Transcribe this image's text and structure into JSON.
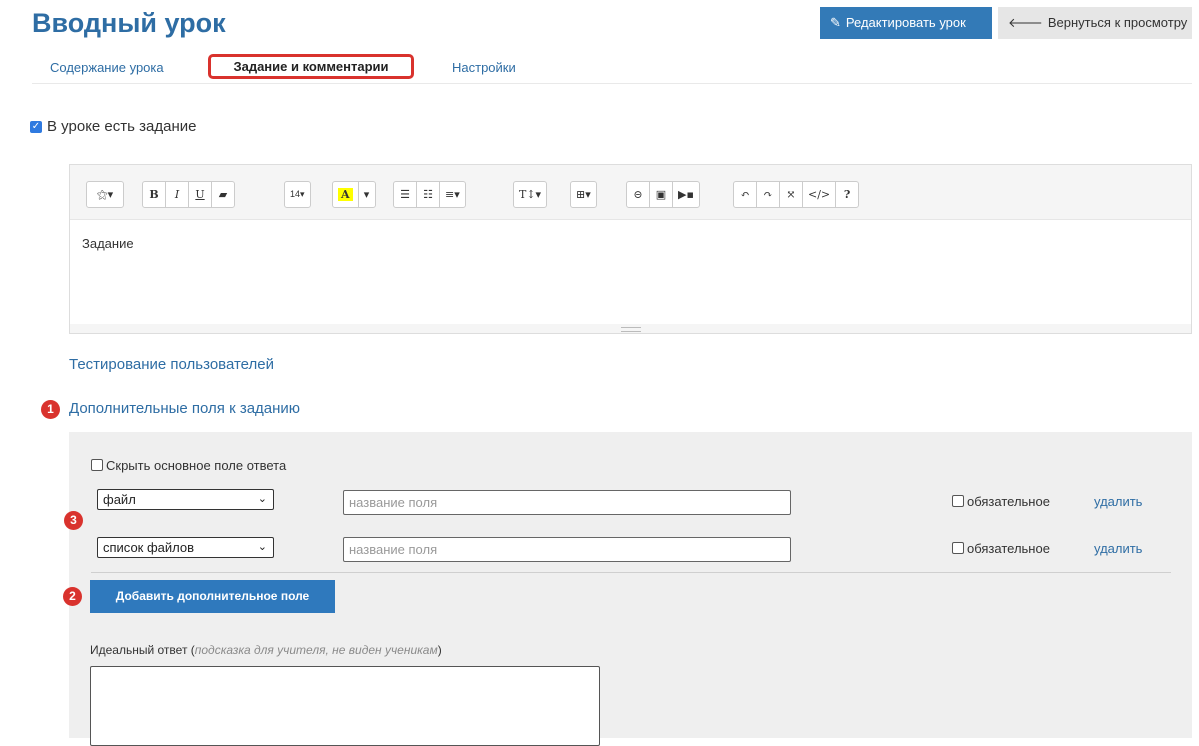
{
  "header": {
    "title": "Вводный урок",
    "edit_label": "Редактировать урок",
    "back_label": "Вернуться к просмотру"
  },
  "tabs": [
    {
      "label": "Содержание урока"
    },
    {
      "label": "Задание и комментарии",
      "active": true
    },
    {
      "label": "Настройки"
    }
  ],
  "has_task": {
    "label": "В уроке есть задание",
    "checked": true
  },
  "editor": {
    "font_size": "14",
    "body_text": "Задание"
  },
  "links": {
    "testing": "Тестирование пользователей",
    "extra_fields": "Дополнительные поля к заданию"
  },
  "badges": {
    "one": "1",
    "two": "2",
    "three": "3"
  },
  "extra_fields": {
    "hide_main_label": "Скрыть основное поле ответа",
    "rows": [
      {
        "type": "файл",
        "placeholder": "название поля",
        "required_label": "обязательное",
        "delete_label": "удалить"
      },
      {
        "type": "список файлов",
        "placeholder": "название поля",
        "required_label": "обязательное",
        "delete_label": "удалить"
      }
    ],
    "add_button": "Добавить дополнительное поле"
  },
  "ideal_answer": {
    "label": "Идеальный ответ",
    "hint": "подсказка для учителя, не виден ученикам"
  },
  "colors": {
    "accent": "#337ab7",
    "highlight_border": "#d9322d",
    "panel": "#efefef"
  }
}
